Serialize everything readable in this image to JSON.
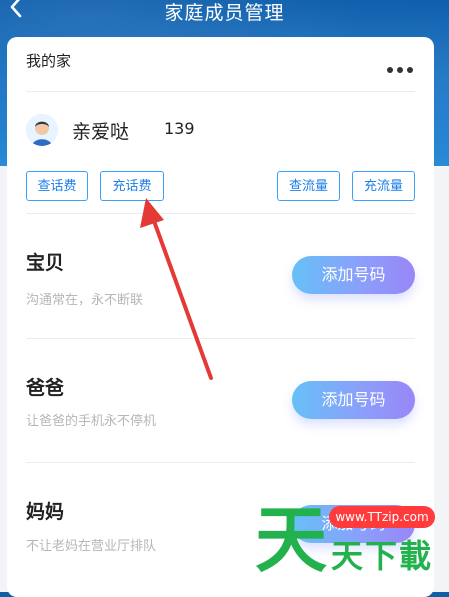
{
  "header": {
    "title": "家庭成员管理",
    "back_icon": "chevron-left-icon"
  },
  "card": {
    "title": "我的家",
    "more_icon": "more-horizontal-icon",
    "member": {
      "name": "亲爱哒",
      "number": "139",
      "avatar_icon": "user-avatar-icon",
      "actions": {
        "check_balance": "查话费",
        "recharge_balance": "充话费",
        "check_data": "查流量",
        "recharge_data": "充流量"
      }
    },
    "slots": [
      {
        "title": "宝贝",
        "subtitle": "沟通常在，永不断联",
        "button": "添加号码"
      },
      {
        "title": "爸爸",
        "subtitle": "让爸爸的手机永不停机",
        "button": "添加号码"
      },
      {
        "title": "妈妈",
        "subtitle": "不让老妈在营业厅排队",
        "button": "添加号码"
      }
    ]
  },
  "watermark": {
    "url": "www.TTzip.com",
    "big": "天",
    "small": "天下載"
  },
  "colors": {
    "accent_blue": "#1c7fe8",
    "outline_blue": "#3aa1ff",
    "pill_start": "#66c0f6",
    "pill_end": "#9a86f7",
    "annotation_red": "#e53935",
    "watermark_green": "#22b14c",
    "watermark_red": "#ff3b3b"
  }
}
